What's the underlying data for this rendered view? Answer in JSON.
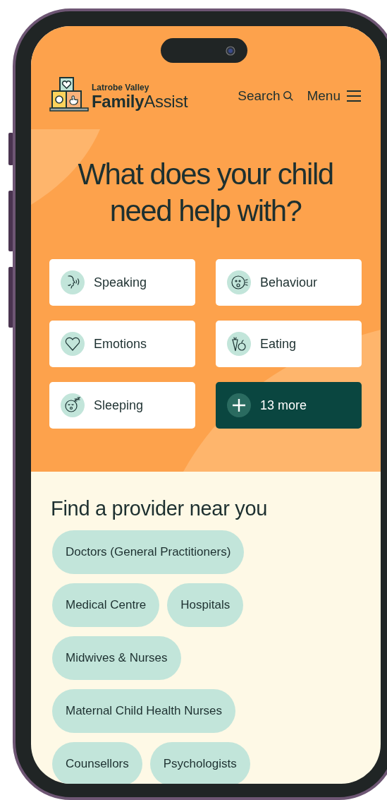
{
  "header": {
    "logo_small": "Latrobe Valley",
    "logo_bold": "Family",
    "logo_light": "Assist",
    "search": "Search",
    "menu": "Menu"
  },
  "hero": {
    "title": "What does your child need help with?",
    "categories": [
      {
        "label": "Speaking",
        "kind": "speaking"
      },
      {
        "label": "Behaviour",
        "kind": "behaviour"
      },
      {
        "label": "Emotions",
        "kind": "emotions"
      },
      {
        "label": "Eating",
        "kind": "eating"
      },
      {
        "label": "Sleeping",
        "kind": "sleeping"
      },
      {
        "label": "13 more",
        "kind": "more"
      }
    ]
  },
  "providers": {
    "title": "Find a provider near you",
    "chips": [
      "Doctors (General Practitioners)",
      "Medical Centre",
      "Hospitals",
      "Midwives & Nurses",
      "Maternal Child Health Nurses",
      "Counsellors",
      "Psychologists"
    ]
  }
}
